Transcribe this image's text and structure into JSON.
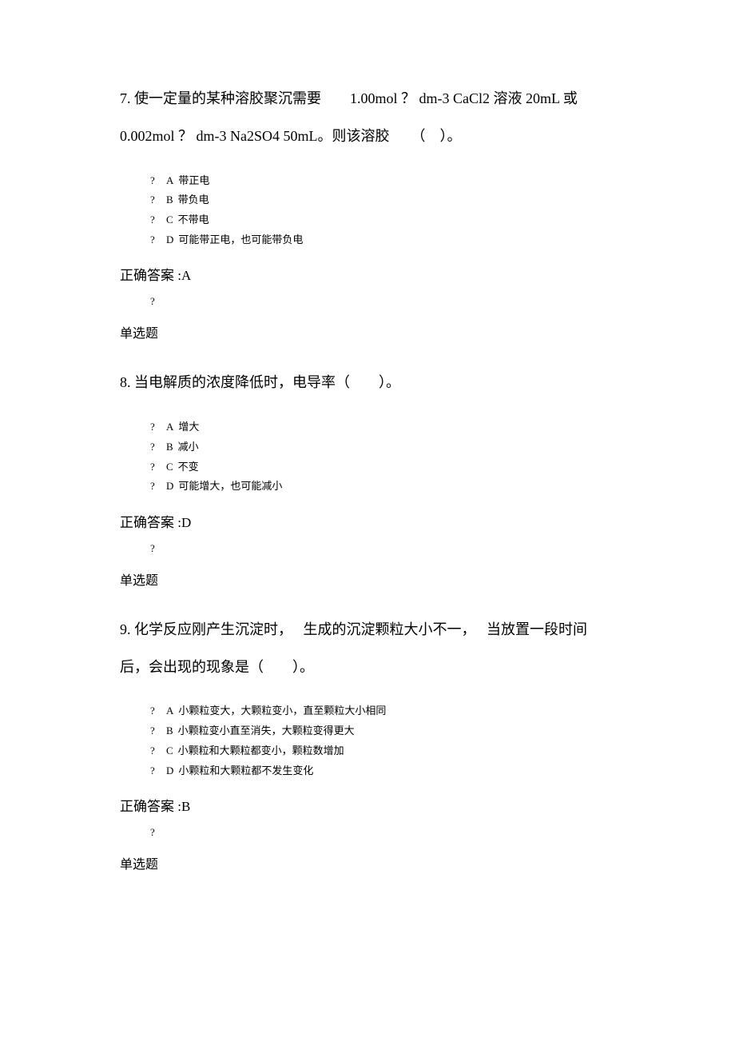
{
  "q7": {
    "stem": "7. 使一定量的某种溶胶聚沉需要　　1.00mol ？ dm-3 CaCl2 溶液 20mL 或 0.002mol ？ dm-3 Na2SO4 50mL。则该溶胶　　（　）。",
    "opts": {
      "A": "带正电",
      "B": "带负电",
      "C": "不带电",
      "D": "可能带正电，也可能带负电"
    },
    "answer": "正确答案 :A",
    "qtype": "单选题"
  },
  "q8": {
    "stem": "8. 当电解质的浓度降低时，电导率（　　）。",
    "opts": {
      "A": "增大",
      "B": "减小",
      "C": "不变",
      "D": "可能增大，也可能减小"
    },
    "answer": "正确答案 :D",
    "qtype": "单选题"
  },
  "q9": {
    "stem": "9. 化学反应刚产生沉淀时，　 生成的沉淀颗粒大小不一，　 当放置一段时间后，会出现的现象是（　　）。",
    "opts": {
      "A": "小颗粒变大，大颗粒变小，直至颗粒大小相同",
      "B": "小颗粒变小直至消失，大颗粒变得更大",
      "C": "小颗粒和大颗粒都变小，颗粒数增加",
      "D": "小颗粒和大颗粒都不发生变化"
    },
    "answer": "正确答案 :B",
    "qtype": "单选题"
  },
  "marks": {
    "q": "?",
    "A": "A",
    "B": "B",
    "C": "C",
    "D": "D"
  }
}
